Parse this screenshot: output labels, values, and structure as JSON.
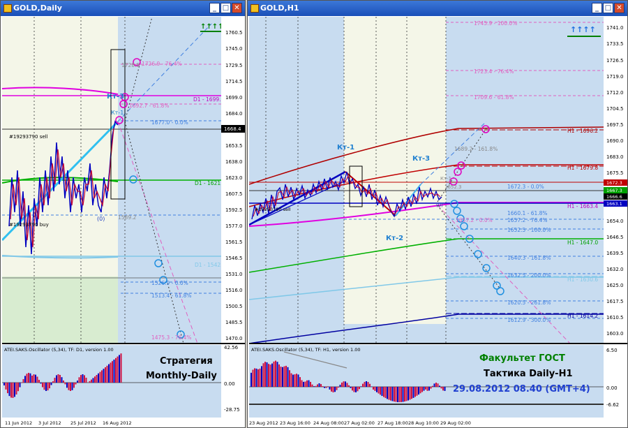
{
  "left_window": {
    "title": "GOLD,Daily",
    "buttons": {
      "minimize": "_",
      "maximize": "□",
      "close": "✕"
    },
    "price_ticks": [
      "1760.5",
      "1745.0",
      "1729.5",
      "1714.5",
      "1699.0",
      "1684.0",
      "1668.4",
      "1653.5",
      "1638.0",
      "1623.0",
      "1607.5",
      "1592.5",
      "1577.0",
      "1561.5",
      "1546.5",
      "1531.0",
      "1516.0",
      "1500.5",
      "1485.5",
      "1470.0"
    ],
    "current_price": "1668.4",
    "osc_ticks": [
      "42.56",
      "0.00",
      "-28.75"
    ],
    "date_ticks": [
      "11 Jun 2012",
      "3 Jul 2012",
      "25 Jul 2012",
      "16 Aug 2012"
    ],
    "arrows": "↑↑↑↑",
    "level_labels": {
      "d1_1699": "D1 - 1699.1",
      "d1_1621": "D1 - 1621.0",
      "d1_1542": "D1 - 1542.9",
      "fib_1729": "1728.8 -",
      "fib_1726": "1726.9 - 76.4%",
      "fib_1692": "1692.7 - 61.8%",
      "fib_1677": "1677.0 - 0.0%",
      "fib_1589": "1589.2",
      "fib_1526": "1526.9 - 0.0%",
      "fib_1513": "1513.4 - 61.8%",
      "fib_1475": "1475.3 - 76.4%",
      "kt3": "Кт-3",
      "kt1": "Кт-1",
      "zero": "(0)",
      "order_sell": "#19293790 sell",
      "order_buy": "#19293790 buy"
    },
    "osc_title": "ATEI.SAKS.Oscillator (5,34), TF: D1, version 1.00",
    "strategy_line1": "Стратегия",
    "strategy_line2": "Monthly-Daily"
  },
  "right_window": {
    "title": "GOLD,H1",
    "buttons": {
      "minimize": "_",
      "maximize": "□",
      "close": "✕"
    },
    "price_ticks": [
      "1741.0",
      "1733.5",
      "1726.5",
      "1719.0",
      "1712.0",
      "1704.5",
      "1697.5",
      "1690.0",
      "1683.0",
      "1675.5",
      "1668.5",
      "1661.0",
      "1654.0",
      "1646.5",
      "1639.5",
      "1632.0",
      "1625.0",
      "1617.5",
      "1610.5",
      "1603.0"
    ],
    "price_tags": [
      "1672.3",
      "1667.3",
      "1666.6",
      "1663.1"
    ],
    "osc_ticks": [
      "6.50",
      "0.00",
      "-6.62"
    ],
    "date_ticks": [
      "23 Aug 2012",
      "23 Aug 16:00",
      "24 Aug 08:00",
      "27 Aug 02:00",
      "27 Aug 18:00",
      "28 Aug 10:00",
      "29 Aug 02:00"
    ],
    "arrows": "↑↑↑↑",
    "level_labels": {
      "fib_1745": "1745.9 - 100.0%",
      "fib_1723": "1723.4 - 76.4%",
      "fib_1709": "1709.6 - 61.8%",
      "fib_1689": "1689.2 - 161.8%",
      "fib_1672": "1672.3 - 0.0%",
      "fib_1660": "1660.1 - 61.8%",
      "fib_1657": "1657.2 - 0.0%",
      "fib_1657b": "1657.2 - 76.4%",
      "fib_1652": "1652.5 - 100.0%",
      "fib_1640": "1640.3 - 161.8%",
      "fib_1632": "1632.5 - 200.0%",
      "fib_1620": "1620.5 - 261.8%",
      "fib_1612": "1612.9 - 300.0%",
      "h1_1696": "H1 - 1696.2",
      "h1_1679": "H1 - 1679.8",
      "h1_1663": "H1 - 1663.4",
      "h1_1647": "H1 - 1647.0",
      "h1_1630": "H1 - 1630.6",
      "h1_1614": "H1 - 1614.2",
      "kt1": "Кт-1",
      "kt3": "Кт-3",
      "kt2": "Кт-2",
      "kt_small": "Кт-1",
      "kt2_small": "1652.3",
      "order": "#19293790 sell",
      "zero": "(0)"
    },
    "osc_title": "ATEI.SAKS.Oscillator (5,34), TF: H1, version 1.00",
    "faculty": "Факультет ГОСТ",
    "tactic": "Тактика Daily-H1",
    "datetime": "29.08.2012  08.40 (GMT+4)"
  },
  "colors": {
    "chart_bg": "#c8dcf0",
    "highlight_zone": "#f4f6e8",
    "bar_blue": "#0000c0",
    "bar_red": "#c00030",
    "d1_magenta": "#e000e0",
    "h1_red": "#c00000",
    "green_line": "#00b000",
    "light_blue_line": "#80c8e8",
    "darkblue_line": "#0000a0",
    "fib_pink": "#e060c0",
    "fib_blue": "#4080e0",
    "green_text": "#008000"
  }
}
